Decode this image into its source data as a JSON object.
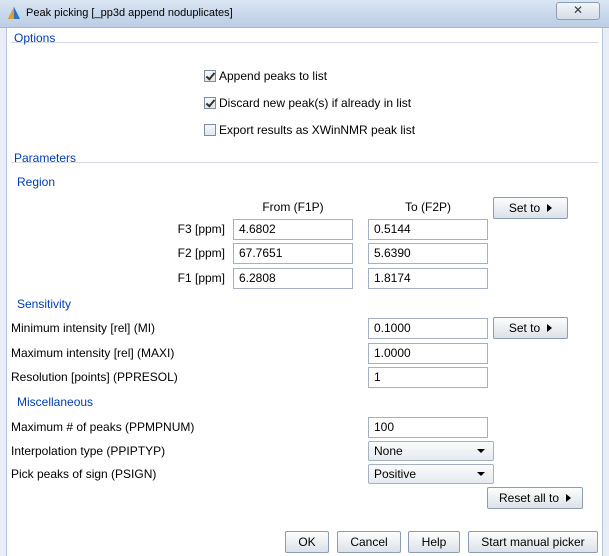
{
  "window": {
    "title": "Peak picking [_pp3d append noduplicates]",
    "close_label": "✕"
  },
  "options": {
    "header": "Options",
    "append_peaks": {
      "label": "Append peaks to list",
      "checked": true
    },
    "discard_new": {
      "label": "Discard new peak(s) if already in list",
      "checked": true
    },
    "export_xwinnmr": {
      "label": "Export results as XWinNMR peak list",
      "checked": false
    }
  },
  "parameters": {
    "header": "Parameters",
    "region": {
      "header": "Region",
      "col_from": "From (F1P)",
      "col_to": "To (F2P)",
      "set_to_label": "Set to",
      "rows": [
        {
          "label": "F3 [ppm]",
          "from": "4.6802",
          "to": "0.5144"
        },
        {
          "label": "F2 [ppm]",
          "from": "67.7651",
          "to": "5.6390"
        },
        {
          "label": "F1 [ppm]",
          "from": "6.2808",
          "to": "1.8174"
        }
      ]
    },
    "sensitivity": {
      "header": "Sensitivity",
      "set_to_label": "Set to",
      "min_intensity": {
        "label": "Minimum intensity [rel] (MI)",
        "value": "0.1000"
      },
      "max_intensity": {
        "label": "Maximum intensity [rel] (MAXI)",
        "value": "1.0000"
      },
      "resolution": {
        "label": "Resolution [points] (PPRESOL)",
        "value": "1"
      }
    },
    "misc": {
      "header": "Miscellaneous",
      "max_peaks": {
        "label": "Maximum # of peaks (PPMPNUM)",
        "value": "100"
      },
      "interpolation": {
        "label": "Interpolation type (PPIPTYP)",
        "value": "None"
      },
      "pick_sign": {
        "label": "Pick peaks of sign (PSIGN)",
        "value": "Positive"
      },
      "reset_all_label": "Reset all to"
    }
  },
  "footer": {
    "ok": "OK",
    "cancel": "Cancel",
    "help": "Help",
    "manual_picker": "Start manual picker"
  },
  "colors": {
    "section_header": "#003cb4",
    "titlebar": "#c9d8eb",
    "border": "#a5b1c1"
  }
}
